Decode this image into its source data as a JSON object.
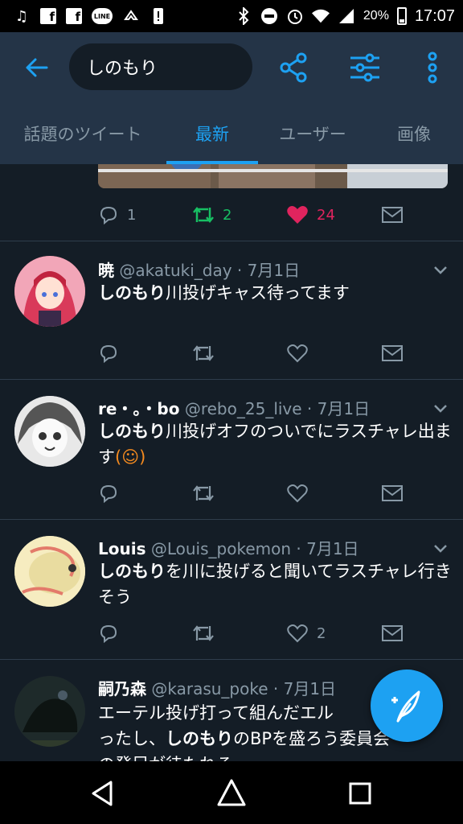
{
  "status_bar": {
    "battery": "20%",
    "time": "17:07",
    "line_badge": "LINE"
  },
  "search": {
    "query": "しのもり"
  },
  "tabs": [
    {
      "label": "話題のツイート"
    },
    {
      "label": "最新"
    },
    {
      "label": "ユーザー"
    },
    {
      "label": "画像"
    }
  ],
  "top_tweet": {
    "replies": "1",
    "retweets": "2",
    "likes": "24"
  },
  "tweets": [
    {
      "name": "暁",
      "meta": "@akatuki_day · 7月1日",
      "text_highlight": "しのもり",
      "text_rest": "川投げキャス待ってます",
      "replies": "",
      "retweets": "",
      "likes": ""
    },
    {
      "name": "re・。・bo",
      "meta": "@rebo_25_live · 7月1日",
      "text_highlight": "しのもり",
      "text_rest": "川投げオフのついでにラスチャレ出ます",
      "emoji": "(☺)",
      "replies": "",
      "retweets": "",
      "likes": ""
    },
    {
      "name": "Louis",
      "meta": "@Louis_pokemon · 7月1日",
      "text_highlight": "しのもり",
      "text_rest": "を川に投げると聞いてラスチャレ行きそう",
      "replies": "",
      "retweets": "",
      "likes": "2"
    },
    {
      "name": "嗣乃森",
      "meta": "@karasu_poke · 7月1日",
      "text_pre": "エーテル投げ打って組んだエル",
      "text_line2_pre": "ったし、",
      "text_highlight": "しのもり",
      "text_line2_post": "のBPを盛ろう委員会",
      "text_line3": "の発足が待たれる"
    }
  ],
  "colors": {
    "accent": "#1da1f2",
    "like": "#e0245e",
    "retweet": "#17bf63",
    "muted": "#8899a6",
    "bg": "#141d26",
    "header": "#243447"
  }
}
